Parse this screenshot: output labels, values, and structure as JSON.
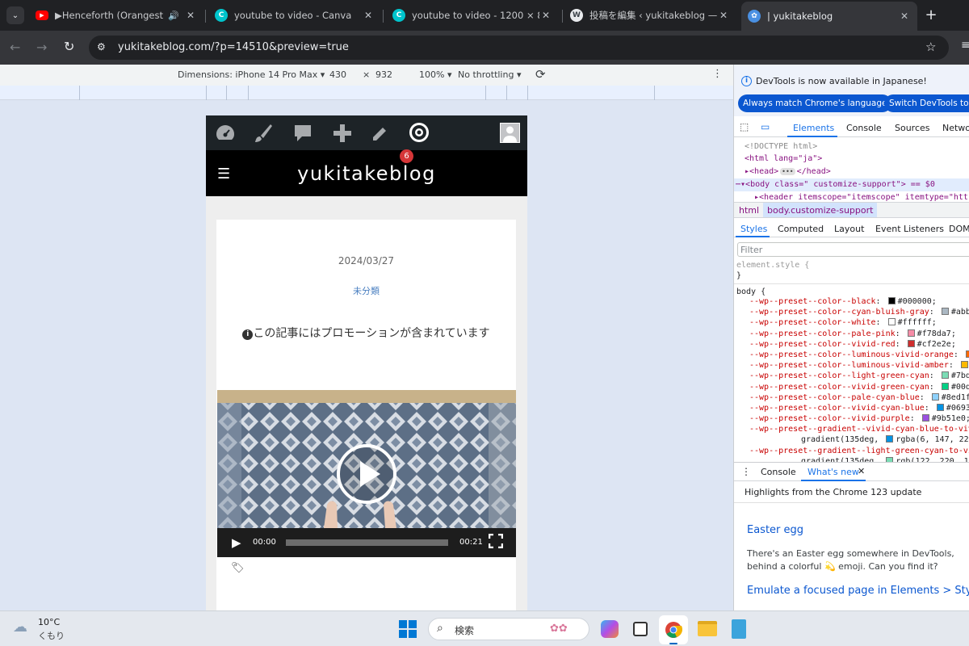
{
  "tabs": [
    {
      "title": "▶Henceforth (Orangestar) ,",
      "color": "#ff0000"
    },
    {
      "title": "youtube to video - Canva",
      "color": "#00c4cc"
    },
    {
      "title": "youtube to video - 1200 × 800px",
      "color": "#00c4cc"
    },
    {
      "title": "投稿を編集 ‹ yukitakeblog — W",
      "color": "#3c8dbc"
    },
    {
      "title": "| yukitakeblog",
      "color": "#4a90e2"
    }
  ],
  "url": "yukitakeblog.com/?p=14510&preview=true",
  "device": {
    "dimensions": "Dimensions: iPhone 14 Pro Max",
    "width": "430",
    "height": "932",
    "zoom": "100%",
    "throttling": "No throttling",
    "x": "×"
  },
  "site": {
    "title": "yukitakeblog",
    "badge": "6",
    "date": "2024/03/27",
    "category": "未分類",
    "promo": "この記事にはプロモーションが含まれています",
    "time_current": "00:00",
    "time_total": "00:21"
  },
  "devtools": {
    "notice": "DevTools is now available in Japanese!",
    "btn_match": "Always match Chrome's language",
    "btn_switch": "Switch DevTools to J",
    "tabs": [
      "Elements",
      "Console",
      "Sources",
      "Netwo"
    ],
    "dom": [
      "<!DOCTYPE html>",
      "<html lang=\"ja\">",
      "<head>",
      "</head>",
      "<body class=\" customize-support\"> == $0",
      "<header itemscope=\"itemscope\" itemtype=\"htt"
    ],
    "crumbs": [
      "html",
      "body.customize-support"
    ],
    "styletabs": [
      "Styles",
      "Computed",
      "Layout",
      "Event Listeners",
      "DOM"
    ],
    "filter": "Filter",
    "elstyle": "element.style {",
    "close_brace": "}",
    "body_sel": "body {",
    "vars": [
      {
        "name": "--wp--preset--color--black",
        "val": "#000000;",
        "sw": "#000000"
      },
      {
        "name": "--wp--preset--color--cyan-bluish-gray",
        "val": "#abb8",
        "sw": "#abb8c3"
      },
      {
        "name": "--wp--preset--color--white",
        "val": "#ffffff;",
        "sw": "#ffffff"
      },
      {
        "name": "--wp--preset--color--pale-pink",
        "val": "#f78da7;",
        "sw": "#f78da7"
      },
      {
        "name": "--wp--preset--color--vivid-red",
        "val": "#cf2e2e;",
        "sw": "#cf2e2e"
      },
      {
        "name": "--wp--preset--color--luminous-vivid-orange",
        "val": "",
        "sw": "#ff6900"
      },
      {
        "name": "--wp--preset--color--luminous-vivid-amber",
        "val": "#",
        "sw": "#fcb900"
      },
      {
        "name": "--wp--preset--color--light-green-cyan",
        "val": "#7bdc",
        "sw": "#7bdcb5"
      },
      {
        "name": "--wp--preset--color--vivid-green-cyan",
        "val": "#00d0",
        "sw": "#00d084"
      },
      {
        "name": "--wp--preset--color--pale-cyan-blue",
        "val": "#8ed1fc",
        "sw": "#8ed1fc"
      },
      {
        "name": "--wp--preset--color--vivid-cyan-blue",
        "val": "#0693e",
        "sw": "#0693e3"
      },
      {
        "name": "--wp--preset--color--vivid-purple",
        "val": "#9b51e0;",
        "sw": "#9b51e0"
      }
    ],
    "grad1": "--wp--preset--gradient--vivid-cyan-blue-to-vivi",
    "grad1b": "gradient(135deg, ",
    "grad1c": "rgba(6, 147, 227, 1)",
    "grad2": "--wp--preset--gradient--light-green-cyan-to-vi",
    "grad2b": "gradient(135deg, ",
    "grad2c": "rgb(122, 220, 180) 0%",
    "drawer_console": "Console",
    "drawer_whatsnew": "What's new",
    "highlights": "Highlights from the Chrome 123 update",
    "easter_title": "Easter egg",
    "easter_body": "There's an Easter egg somewhere in DevTools, behind a colorful 💫 emoji. Can you find it?",
    "emulate": "Emulate a focused page in Elements > Styles"
  },
  "taskbar": {
    "temp": "10°C",
    "weather": "くもり",
    "search": "検索"
  }
}
